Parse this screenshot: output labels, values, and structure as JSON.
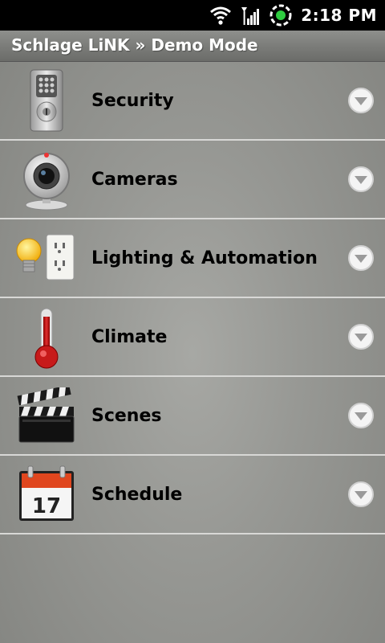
{
  "status_bar": {
    "time": "2:18 PM",
    "icons": [
      "wifi-icon",
      "signal-icon",
      "sync-icon"
    ]
  },
  "title_bar": {
    "title": "Schlage LiNK » Demo Mode"
  },
  "menu": {
    "items": [
      {
        "label": "Security",
        "icon": "lock-icon"
      },
      {
        "label": "Cameras",
        "icon": "camera-icon"
      },
      {
        "label": "Lighting & Automation",
        "icon": "bulb-outlet-icon"
      },
      {
        "label": "Climate",
        "icon": "thermometer-icon"
      },
      {
        "label": "Scenes",
        "icon": "clapperboard-icon"
      },
      {
        "label": "Schedule",
        "icon": "calendar-icon",
        "calendar_day": "17"
      }
    ]
  },
  "colors": {
    "status_bar_bg": "#000000",
    "background": "#979894",
    "divider": "#d8d8d6"
  }
}
